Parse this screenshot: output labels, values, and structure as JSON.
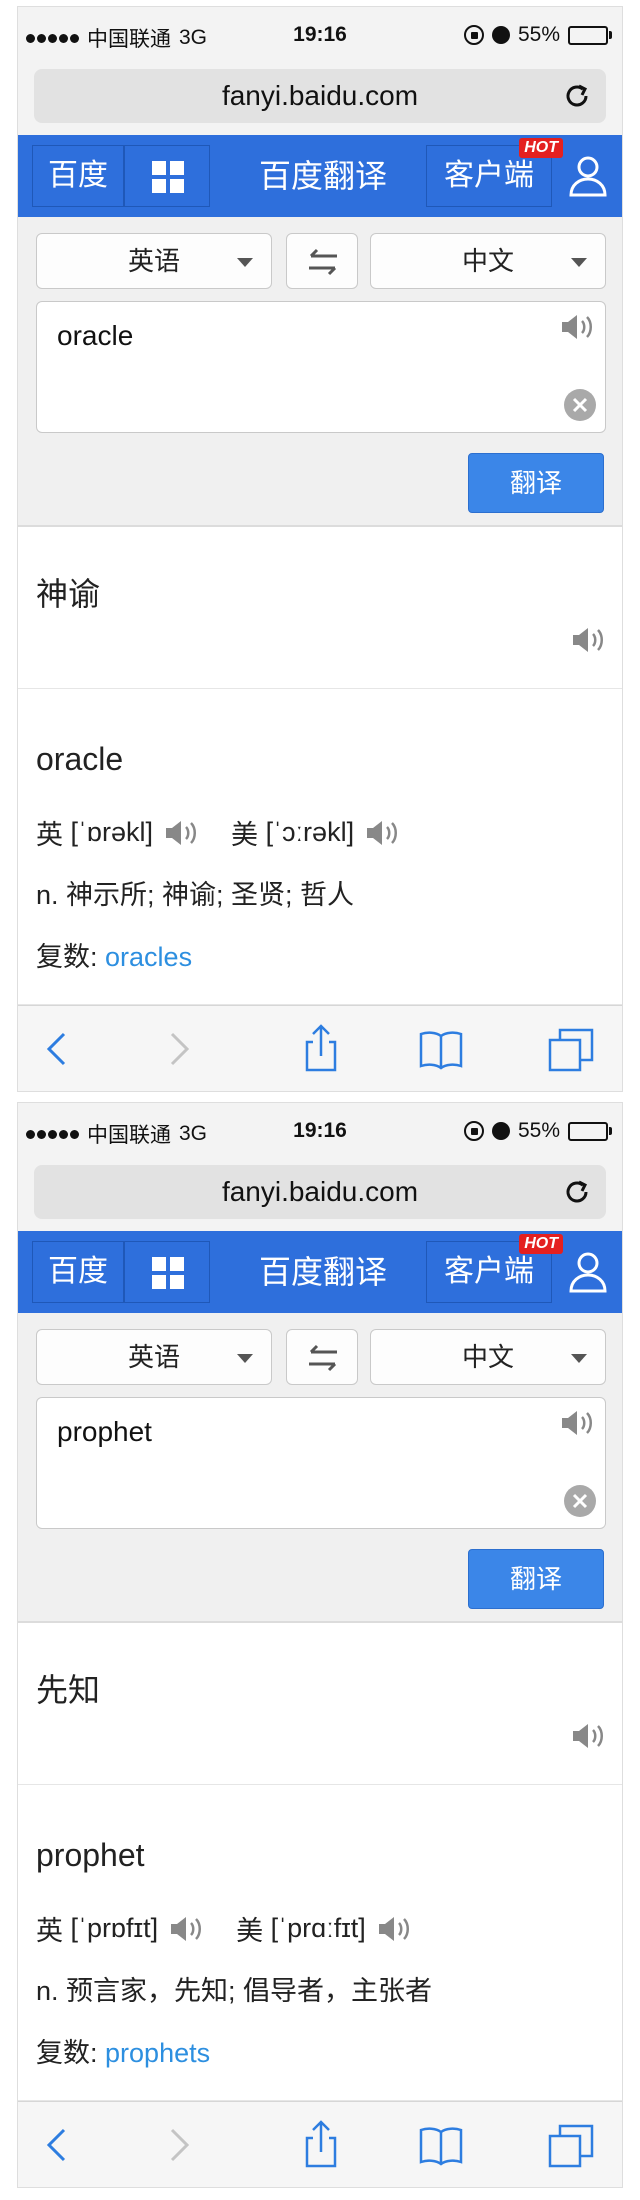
{
  "screens": [
    {
      "status": {
        "carrier": "中国联通",
        "network": "3G",
        "time": "19:16",
        "battery": "55%",
        "battery_level": 0.55
      },
      "url": "fanyi.baidu.com",
      "header": {
        "baidu_label": "百度",
        "title": "百度翻译",
        "client_label": "客户端",
        "hot_badge": "HOT"
      },
      "form": {
        "from_lang": "英语",
        "to_lang": "中文",
        "input_text": "oracle",
        "translate_label": "翻译"
      },
      "result": {
        "translation": "神谕"
      },
      "dict": {
        "headword": "oracle",
        "uk_label": "英",
        "uk_phonetic": "[ˈɒrəkl]",
        "us_label": "美",
        "us_phonetic": "[ˈɔːrəkl]",
        "definition": "n. 神示所; 神谕; 圣贤; 哲人",
        "plural_label": "复数:",
        "plural_value": "oracles"
      }
    },
    {
      "status": {
        "carrier": "中国联通",
        "network": "3G",
        "time": "19:16",
        "battery": "55%",
        "battery_level": 0.55
      },
      "url": "fanyi.baidu.com",
      "header": {
        "baidu_label": "百度",
        "title": "百度翻译",
        "client_label": "客户端",
        "hot_badge": "HOT"
      },
      "form": {
        "from_lang": "英语",
        "to_lang": "中文",
        "input_text": "prophet",
        "translate_label": "翻译"
      },
      "result": {
        "translation": "先知"
      },
      "dict": {
        "headword": "prophet",
        "uk_label": "英",
        "uk_phonetic": "[ˈprɒfɪt]",
        "us_label": "美",
        "us_phonetic": "[ˈprɑːfɪt]",
        "definition": "n. 预言家，先知; 倡导者，主张者",
        "plural_label": "复数:",
        "plural_value": "prophets"
      }
    }
  ],
  "colors": {
    "brand_blue": "#2e6fdc",
    "button_blue": "#3b86e8",
    "link_blue": "#2d8fe0",
    "hot_red": "#e42020"
  },
  "icons": [
    "signal-icon",
    "lock-rotation-icon",
    "alarm-icon",
    "battery-icon",
    "reload-icon",
    "grid-icon",
    "user-icon",
    "caret-icon",
    "swap-icon",
    "speaker-icon",
    "clear-icon",
    "back-icon",
    "forward-icon",
    "share-icon",
    "bookmarks-icon",
    "tabs-icon"
  ]
}
